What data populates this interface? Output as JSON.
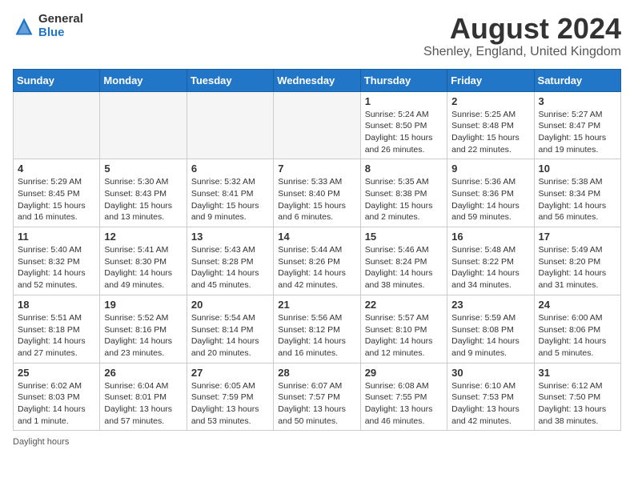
{
  "header": {
    "logo_general": "General",
    "logo_blue": "Blue",
    "month_year": "August 2024",
    "location": "Shenley, England, United Kingdom"
  },
  "days_of_week": [
    "Sunday",
    "Monday",
    "Tuesday",
    "Wednesday",
    "Thursday",
    "Friday",
    "Saturday"
  ],
  "footer": {
    "daylight_hours": "Daylight hours"
  },
  "weeks": [
    [
      {
        "day": "",
        "info": ""
      },
      {
        "day": "",
        "info": ""
      },
      {
        "day": "",
        "info": ""
      },
      {
        "day": "",
        "info": ""
      },
      {
        "day": "1",
        "info": "Sunrise: 5:24 AM\nSunset: 8:50 PM\nDaylight: 15 hours\nand 26 minutes."
      },
      {
        "day": "2",
        "info": "Sunrise: 5:25 AM\nSunset: 8:48 PM\nDaylight: 15 hours\nand 22 minutes."
      },
      {
        "day": "3",
        "info": "Sunrise: 5:27 AM\nSunset: 8:47 PM\nDaylight: 15 hours\nand 19 minutes."
      }
    ],
    [
      {
        "day": "4",
        "info": "Sunrise: 5:29 AM\nSunset: 8:45 PM\nDaylight: 15 hours\nand 16 minutes."
      },
      {
        "day": "5",
        "info": "Sunrise: 5:30 AM\nSunset: 8:43 PM\nDaylight: 15 hours\nand 13 minutes."
      },
      {
        "day": "6",
        "info": "Sunrise: 5:32 AM\nSunset: 8:41 PM\nDaylight: 15 hours\nand 9 minutes."
      },
      {
        "day": "7",
        "info": "Sunrise: 5:33 AM\nSunset: 8:40 PM\nDaylight: 15 hours\nand 6 minutes."
      },
      {
        "day": "8",
        "info": "Sunrise: 5:35 AM\nSunset: 8:38 PM\nDaylight: 15 hours\nand 2 minutes."
      },
      {
        "day": "9",
        "info": "Sunrise: 5:36 AM\nSunset: 8:36 PM\nDaylight: 14 hours\nand 59 minutes."
      },
      {
        "day": "10",
        "info": "Sunrise: 5:38 AM\nSunset: 8:34 PM\nDaylight: 14 hours\nand 56 minutes."
      }
    ],
    [
      {
        "day": "11",
        "info": "Sunrise: 5:40 AM\nSunset: 8:32 PM\nDaylight: 14 hours\nand 52 minutes."
      },
      {
        "day": "12",
        "info": "Sunrise: 5:41 AM\nSunset: 8:30 PM\nDaylight: 14 hours\nand 49 minutes."
      },
      {
        "day": "13",
        "info": "Sunrise: 5:43 AM\nSunset: 8:28 PM\nDaylight: 14 hours\nand 45 minutes."
      },
      {
        "day": "14",
        "info": "Sunrise: 5:44 AM\nSunset: 8:26 PM\nDaylight: 14 hours\nand 42 minutes."
      },
      {
        "day": "15",
        "info": "Sunrise: 5:46 AM\nSunset: 8:24 PM\nDaylight: 14 hours\nand 38 minutes."
      },
      {
        "day": "16",
        "info": "Sunrise: 5:48 AM\nSunset: 8:22 PM\nDaylight: 14 hours\nand 34 minutes."
      },
      {
        "day": "17",
        "info": "Sunrise: 5:49 AM\nSunset: 8:20 PM\nDaylight: 14 hours\nand 31 minutes."
      }
    ],
    [
      {
        "day": "18",
        "info": "Sunrise: 5:51 AM\nSunset: 8:18 PM\nDaylight: 14 hours\nand 27 minutes."
      },
      {
        "day": "19",
        "info": "Sunrise: 5:52 AM\nSunset: 8:16 PM\nDaylight: 14 hours\nand 23 minutes."
      },
      {
        "day": "20",
        "info": "Sunrise: 5:54 AM\nSunset: 8:14 PM\nDaylight: 14 hours\nand 20 minutes."
      },
      {
        "day": "21",
        "info": "Sunrise: 5:56 AM\nSunset: 8:12 PM\nDaylight: 14 hours\nand 16 minutes."
      },
      {
        "day": "22",
        "info": "Sunrise: 5:57 AM\nSunset: 8:10 PM\nDaylight: 14 hours\nand 12 minutes."
      },
      {
        "day": "23",
        "info": "Sunrise: 5:59 AM\nSunset: 8:08 PM\nDaylight: 14 hours\nand 9 minutes."
      },
      {
        "day": "24",
        "info": "Sunrise: 6:00 AM\nSunset: 8:06 PM\nDaylight: 14 hours\nand 5 minutes."
      }
    ],
    [
      {
        "day": "25",
        "info": "Sunrise: 6:02 AM\nSunset: 8:03 PM\nDaylight: 14 hours\nand 1 minute."
      },
      {
        "day": "26",
        "info": "Sunrise: 6:04 AM\nSunset: 8:01 PM\nDaylight: 13 hours\nand 57 minutes."
      },
      {
        "day": "27",
        "info": "Sunrise: 6:05 AM\nSunset: 7:59 PM\nDaylight: 13 hours\nand 53 minutes."
      },
      {
        "day": "28",
        "info": "Sunrise: 6:07 AM\nSunset: 7:57 PM\nDaylight: 13 hours\nand 50 minutes."
      },
      {
        "day": "29",
        "info": "Sunrise: 6:08 AM\nSunset: 7:55 PM\nDaylight: 13 hours\nand 46 minutes."
      },
      {
        "day": "30",
        "info": "Sunrise: 6:10 AM\nSunset: 7:53 PM\nDaylight: 13 hours\nand 42 minutes."
      },
      {
        "day": "31",
        "info": "Sunrise: 6:12 AM\nSunset: 7:50 PM\nDaylight: 13 hours\nand 38 minutes."
      }
    ]
  ]
}
